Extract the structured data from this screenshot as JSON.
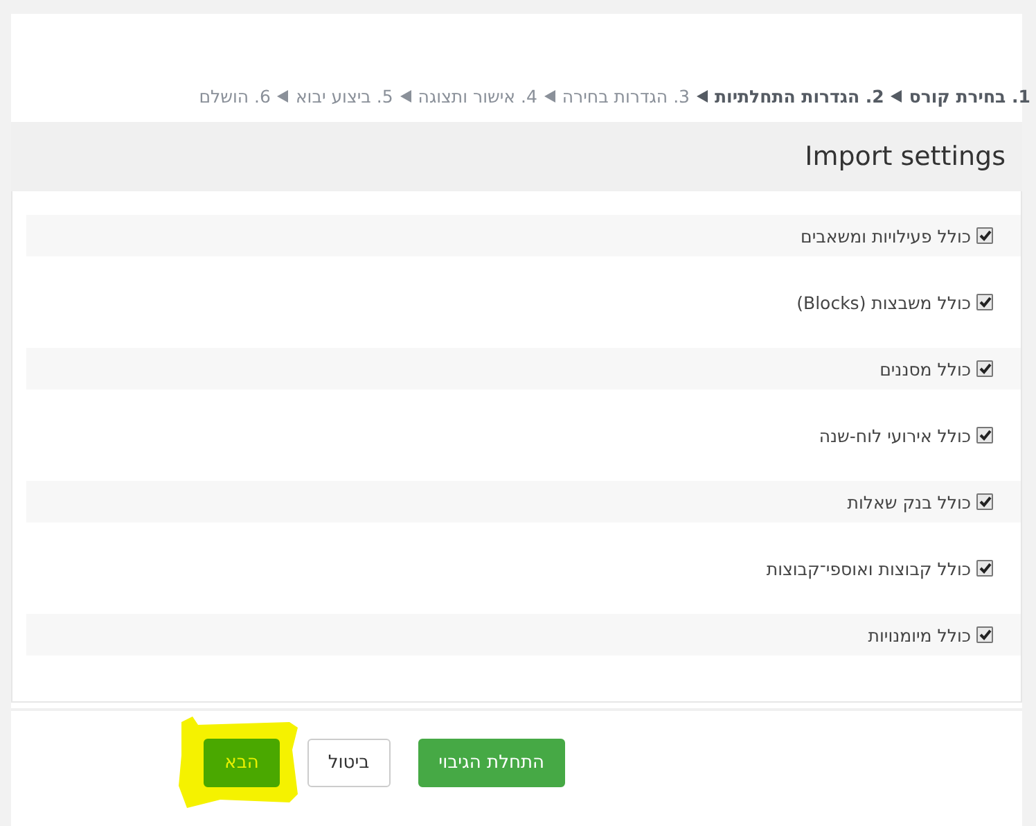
{
  "steps": [
    {
      "label": "1. בחירת קורס",
      "reached": true
    },
    {
      "label": "2. הגדרות התחלתיות",
      "reached": true
    },
    {
      "label": "3. הגדרות בחירה",
      "reached": false
    },
    {
      "label": "4. אישור ותצוגה",
      "reached": false
    },
    {
      "label": "5. ביצוע יבוא",
      "reached": false
    },
    {
      "label": "6. הושלם",
      "reached": false
    }
  ],
  "section": {
    "title": "Import settings"
  },
  "options": [
    {
      "label": "כולל פעילויות ומשאבים",
      "checked": true
    },
    {
      "label": "כולל משבצות (Blocks)",
      "checked": true
    },
    {
      "label": "כולל מסננים",
      "checked": true
    },
    {
      "label": "כולל אירועי לוח-שנה",
      "checked": true
    },
    {
      "label": "כולל בנק שאלות",
      "checked": true
    },
    {
      "label": "כולל קבוצות ואוספי־קבוצות",
      "checked": true
    },
    {
      "label": "כולל מיומנויות",
      "checked": true
    }
  ],
  "buttons": [
    {
      "label": "התחלת הגיבוי",
      "kind": "primary",
      "highlighted": false
    },
    {
      "label": "ביטול",
      "kind": "secondary",
      "highlighted": false
    },
    {
      "label": "הבא",
      "kind": "primary",
      "highlighted": true
    }
  ]
}
